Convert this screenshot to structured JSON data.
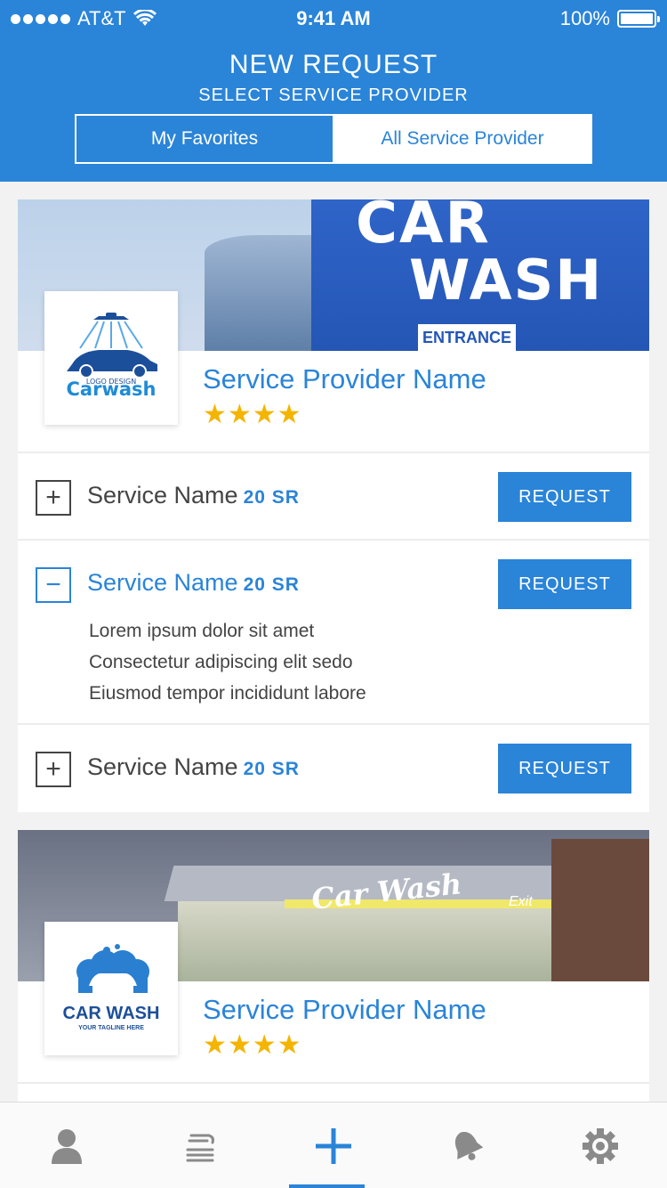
{
  "status_bar": {
    "carrier": "AT&T",
    "time": "9:41 AM",
    "battery": "100%"
  },
  "header": {
    "title": "NEW REQUEST",
    "subtitle": "SELECT SERVICE PROVIDER",
    "tabs": [
      {
        "label": "My Favorites",
        "active": true
      },
      {
        "label": "All Service Provider",
        "active": false
      }
    ]
  },
  "providers": [
    {
      "banner_text_1": "CAR",
      "banner_text_2": "WASH",
      "banner_sign": "ENTRANCE",
      "logo_small": "LOGO DESIGN",
      "logo_text": "Carwash",
      "name": "Service Provider Name",
      "stars": "★★★★",
      "services": [
        {
          "toggle": "+",
          "name": "Service Name",
          "price": "20 SR",
          "button": "REQUEST",
          "expanded": false
        },
        {
          "toggle": "−",
          "name": "Service Name",
          "price": "20 SR",
          "button": "REQUEST",
          "expanded": true,
          "description": [
            "Lorem ipsum dolor sit amet",
            "Consectetur adipiscing elit sedo",
            "Eiusmod tempor incididunt labore"
          ]
        },
        {
          "toggle": "+",
          "name": "Service Name",
          "price": "20 SR",
          "button": "REQUEST",
          "expanded": false
        }
      ]
    },
    {
      "banner_text_1": "Car Wash",
      "banner_sign": "Exit",
      "logo_text": "CAR WASH",
      "logo_tagline": "YOUR TAGLINE HERE",
      "name": "Service Provider Name",
      "stars": "★★★★"
    }
  ],
  "tabbar": [
    {
      "icon": "profile-icon"
    },
    {
      "icon": "car-wash-icon"
    },
    {
      "icon": "plus-icon",
      "active": true
    },
    {
      "icon": "bell-icon"
    },
    {
      "icon": "gear-icon"
    }
  ],
  "colors": {
    "primary": "#2a84d8",
    "star": "#f3b500",
    "text": "#444444"
  }
}
